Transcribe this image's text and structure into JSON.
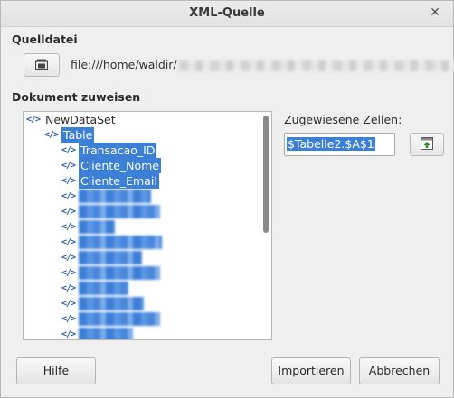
{
  "window": {
    "title": "XML-Quelle",
    "close_glyph": "✕"
  },
  "source": {
    "heading": "Quelldatei",
    "path": "file:///home/waldir/",
    "browse_icon": "folder-icon"
  },
  "document": {
    "heading": "Dokument zuweisen",
    "tree": [
      {
        "label": "NewDataSet",
        "selected": false
      },
      {
        "label": "Table",
        "selected": true
      },
      {
        "label": "Transacao_ID",
        "selected": true
      },
      {
        "label": "Cliente_Nome",
        "selected": true
      },
      {
        "label": "Cliente_Email",
        "selected": true
      }
    ],
    "tag_glyph": "</>"
  },
  "cells": {
    "label": "Zugewiesene Zellen:",
    "value": "$Tabelle2.$A$1",
    "shrink_icon": "shrink-dialog-icon"
  },
  "buttons": {
    "help": "Hilfe",
    "import": "Importieren",
    "cancel": "Abbrechen"
  },
  "colors": {
    "selection": "#3c7fd6",
    "icon": "#2b5ea8",
    "background": "#efefef"
  }
}
